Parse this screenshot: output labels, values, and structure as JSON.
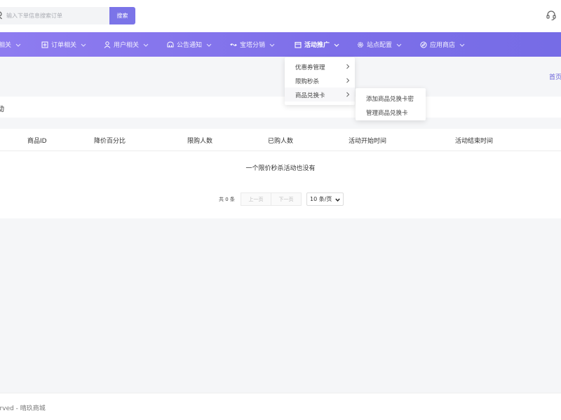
{
  "search": {
    "placeholder": "输入下单信息搜索订单",
    "button_label": "搜索"
  },
  "nav": {
    "items": [
      {
        "label": "相关",
        "icon": "doc-icon",
        "active": false
      },
      {
        "label": "订单相关",
        "icon": "order-icon",
        "active": false
      },
      {
        "label": "用户相关",
        "icon": "user-icon",
        "active": false
      },
      {
        "label": "公告通知",
        "icon": "notice-icon",
        "active": false
      },
      {
        "label": "宝塔分销",
        "icon": "share-icon",
        "active": false
      },
      {
        "label": "活动推广",
        "icon": "calendar-icon",
        "active": true
      },
      {
        "label": "站点配置",
        "icon": "gear-icon",
        "active": false
      },
      {
        "label": "应用商店",
        "icon": "compass-icon",
        "active": false
      }
    ]
  },
  "dropdown": {
    "items": [
      {
        "label": "优惠券管理"
      },
      {
        "label": "限购秒杀"
      },
      {
        "label": "商品兑换卡"
      }
    ],
    "submenu": [
      {
        "label": "添加商品兑换卡密"
      },
      {
        "label": "管理商品兑换卡"
      }
    ]
  },
  "page": {
    "home_link": "首页",
    "card_title": "动"
  },
  "table": {
    "columns": [
      "商品ID",
      "降价百分比",
      "限购人数",
      "已购人数",
      "活动开始时间",
      "活动结束时间"
    ],
    "empty_message": "一个限价秒杀活动也没有"
  },
  "pager": {
    "total": "共 0 条",
    "prev": "上一页",
    "next": "下一页",
    "page_size": "10 条/页"
  },
  "footer": {
    "text": "erved - 晴玖商城"
  },
  "colors": {
    "accent": "#7b74e8",
    "nav_gradient_start": "#8e7cf0",
    "nav_gradient_end": "#766ce6"
  }
}
